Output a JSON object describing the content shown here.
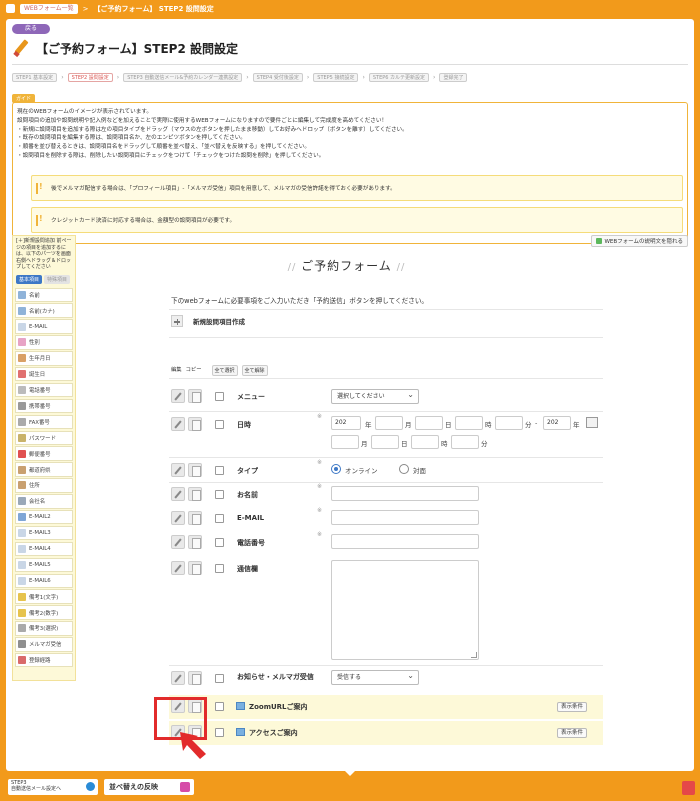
{
  "topbar": {
    "list_link": "WEBフォーム一覧",
    "separator": ">",
    "current": "【ご予約フォーム】 STEP2 設問設定"
  },
  "page": {
    "back_label": "戻る",
    "title": "【ご予約フォーム】STEP2 設問設定"
  },
  "steps": [
    {
      "label": "STEP1 基本設定"
    },
    {
      "label": "STEP2 設問設定"
    },
    {
      "label": "STEP3 自動送信メール&予約カレンダー連携設定"
    },
    {
      "label": "STEP4 受付後設定"
    },
    {
      "label": "STEP5 接続設定"
    },
    {
      "label": "STEP6 カルテ更新設定"
    },
    {
      "label": "登録完了"
    }
  ],
  "guide": {
    "tag": "ガイド",
    "lines": [
      "現在のWEBフォームのイメージが表示されています。",
      "設問項目の追加や設問説明や記入例などを加えることで実際に使用するWEBフォームになりますので要件ごとに編集して完成度を高めてください！",
      "・新規に設問項目を追加する際は左の項目タイプをドラッグ（マウスの左ボタンを押したまま移動）してお好みへドロップ（ボタンを離す）してください。",
      "・既存の設問項目を編集する際は、設問項目名か、左のエンピツボタンを押してください。",
      "・順番を並び替えるときは、設問項目名をドラッグして順番を並べ替え、「並べ替えを反映する」を押してください。",
      "・設問項目を削除する際は、削除したい設問項目にチェックをつけて「チェックをつけた設問を削除」を押してください。"
    ],
    "note1": "後でメルマガ配信する場合は、「プロフィール項目」-「メルマガ受信」項目を用意して、メルマガの受信許諾を得ておく必要があります。",
    "note2": "クレジットカード決済に対応する場合は、金額型の設問項目が必要です。"
  },
  "sidebar": {
    "head": "[＋]新規設問追加 前ページの項目を追加するには、以下のパーツを画面右側へドラッグ＆ドロップしてください",
    "tab_basic": "基本項目",
    "tab_special": "特殊項目",
    "items": [
      {
        "label": "名前"
      },
      {
        "label": "名前(カナ)"
      },
      {
        "label": "E-MAIL"
      },
      {
        "label": "性別"
      },
      {
        "label": "生年月日"
      },
      {
        "label": "誕生日"
      },
      {
        "label": "電話番号"
      },
      {
        "label": "携帯番号"
      },
      {
        "label": "FAX番号"
      },
      {
        "label": "パスワード"
      },
      {
        "label": "郵便番号"
      },
      {
        "label": "都道府県"
      },
      {
        "label": "住所"
      },
      {
        "label": "会社名"
      },
      {
        "label": "E-MAIL2"
      },
      {
        "label": "E-MAIL3"
      },
      {
        "label": "E-MAIL4"
      },
      {
        "label": "E-MAIL5"
      },
      {
        "label": "E-MAIL6"
      },
      {
        "label": "備考1(文字)"
      },
      {
        "label": "備考2(数字)"
      },
      {
        "label": "備考3(選択)"
      },
      {
        "label": "メルマガ受信"
      },
      {
        "label": "登録経路"
      }
    ]
  },
  "form": {
    "desc_button": "WEBフォームの説明文を隠れる",
    "title": "ご予約フォーム",
    "intro": "下のwebフォームに必要事項をご入力いただき「予約送信」ボタンを押してください。",
    "new_question": "新規設問項目作成",
    "col_edit": "編集",
    "col_copy": "コピー",
    "select_all": "全て選択",
    "deselect_all": "全て解除",
    "menu_label": "メニュー",
    "menu_select": "選択してください",
    "datetime_label": "日時",
    "year_val": "202",
    "u_year": "年",
    "u_month": "月",
    "u_day": "日",
    "u_hour": "時",
    "u_min": "分",
    "u_dash": "-",
    "type_label": "タイプ",
    "type_online": "オンライン",
    "type_face": "対面",
    "name_label": "お名前",
    "email_label": "E-MAIL",
    "phone_label": "電話番号",
    "comm_label": "通信欄",
    "mail_label": "お知らせ・メルマガ受信",
    "mail_select": "受信する",
    "zoom_label": "ZoomURLご案内",
    "access_label": "アクセスご案内",
    "cond_button": "表示条件",
    "req_mark": "※"
  },
  "bottom": {
    "back_line1": "STEP3",
    "back_line2": "自動送信メール設定へ",
    "sort_button": "並べ替えの反映"
  }
}
